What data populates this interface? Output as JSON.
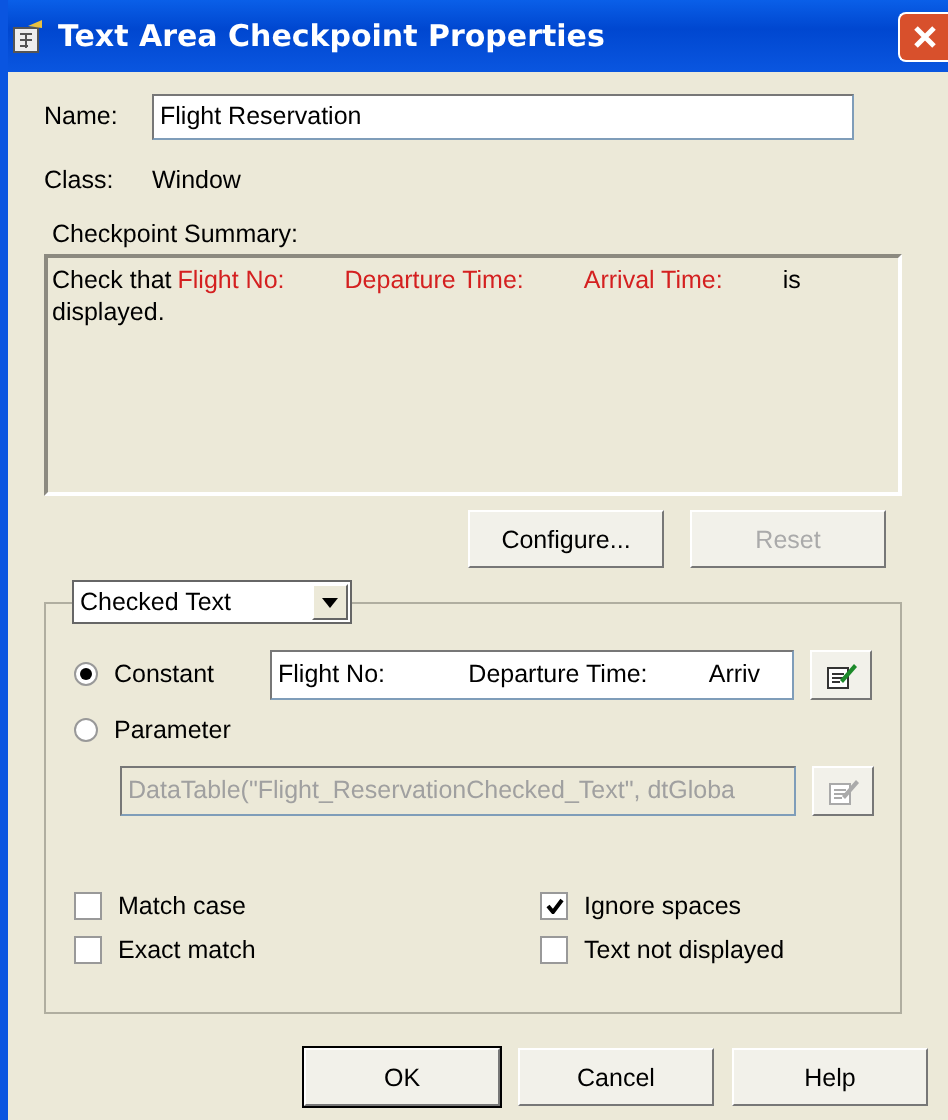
{
  "window": {
    "title": "Text Area Checkpoint Properties"
  },
  "name": {
    "label": "Name:",
    "value": "Flight Reservation"
  },
  "class": {
    "label": "Class:",
    "value": "Window"
  },
  "summary": {
    "label": "Checkpoint Summary:",
    "segments": [
      {
        "text": "Check that",
        "highlight": false
      },
      {
        "text": "Flight No:",
        "highlight": true
      },
      {
        "text": "Departure Time:",
        "highlight": true
      },
      {
        "text": "Arrival Time:",
        "highlight": true
      },
      {
        "text": "is displayed.",
        "highlight": false
      }
    ]
  },
  "summary_buttons": [
    {
      "label": "Configure...",
      "disabled": false
    },
    {
      "label": "Reset",
      "disabled": true
    }
  ],
  "checked_text": {
    "dropdown": "Checked Text",
    "options": [
      {
        "label": "Constant",
        "selected": true,
        "value": "Flight No:            Departure Time:         Arriv",
        "disabled": false
      },
      {
        "label": "Parameter",
        "selected": false,
        "value": "DataTable(\"Flight_ReservationChecked_Text\", dtGloba",
        "disabled": true
      }
    ]
  },
  "checkboxes": [
    {
      "label": "Match case",
      "checked": false
    },
    {
      "label": "Ignore spaces",
      "checked": true
    },
    {
      "label": "Exact match",
      "checked": false
    },
    {
      "label": "Text not displayed",
      "checked": false
    }
  ],
  "buttons": [
    {
      "label": "OK",
      "default": true
    },
    {
      "label": "Cancel",
      "default": false
    },
    {
      "label": "Help",
      "default": false
    }
  ]
}
